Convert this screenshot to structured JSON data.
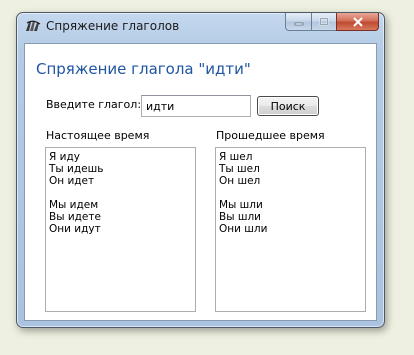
{
  "window": {
    "title": "Спряжение глаголов",
    "icon": "app-icon"
  },
  "main": {
    "heading": "Спряжение глагола \"идти\"",
    "input_label": "Введите глагол:",
    "verb_value": "идти",
    "search_label": "Поиск"
  },
  "present": {
    "label": "Настоящее время",
    "lines": [
      "Я иду",
      "Ты идешь",
      "Он идет",
      "",
      "Мы идем",
      "Вы идете",
      "Они идут"
    ]
  },
  "past": {
    "label": "Прошедшее время",
    "lines": [
      "Я шел",
      "Ты шел",
      "Он шел",
      "",
      "Мы шли",
      "Вы шли",
      "Они шли"
    ]
  },
  "colors": {
    "heading": "#1f55a3",
    "frame": "#b3cbe6",
    "close_button": "#c04a32"
  }
}
